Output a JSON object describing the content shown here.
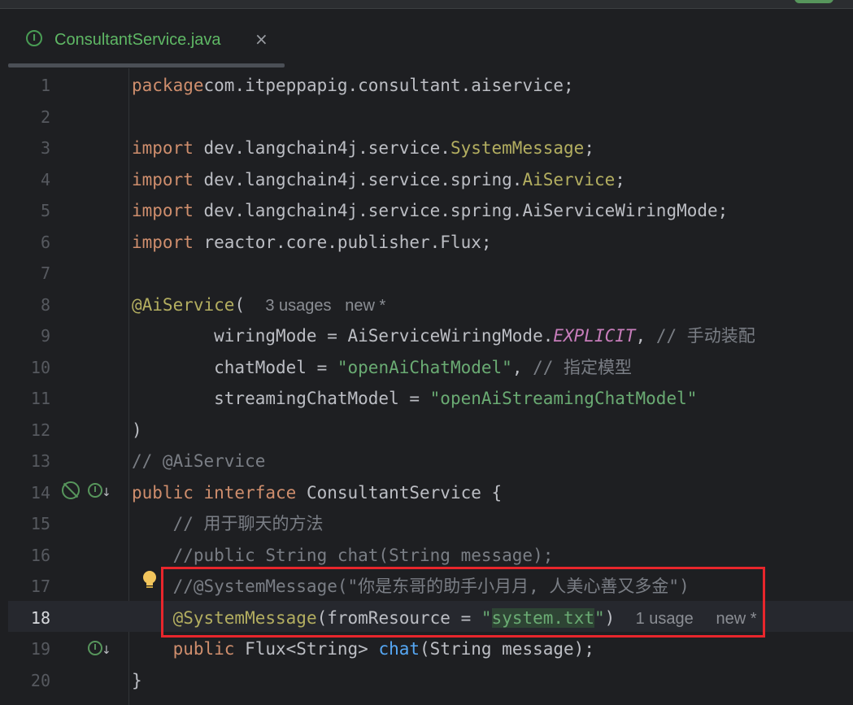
{
  "file_tab": {
    "icon": "interface-icon",
    "icon_letter": "I",
    "name": "ConsultantService.java",
    "close": "×"
  },
  "current_line": 18,
  "gutter_icons": {
    "line_14": [
      "no-implementation-icon",
      "implemented-interface-icon"
    ],
    "line_17": [
      "intention-bulb-icon"
    ],
    "line_19": [
      "implemented-method-icon"
    ]
  },
  "colors": {
    "keyword": "#cf8e6d",
    "annotation": "#b3ae60",
    "string": "#6aab73",
    "comment": "#7a7e85",
    "field": "#c77dbb",
    "method": "#56a8f5",
    "highlight_box": "#e8262c"
  },
  "lines": [
    {
      "n": "1",
      "t": [
        [
          "kw",
          "package"
        ],
        [
          "",
          "com.itpeppapig.consultant.aiservice;"
        ]
      ]
    },
    {
      "n": "2",
      "t": []
    },
    {
      "n": "3",
      "t": [
        [
          "kw",
          "import"
        ],
        [
          "",
          " dev.langchain4j.service."
        ],
        [
          "ann",
          "SystemMessage"
        ],
        [
          "",
          ";"
        ]
      ]
    },
    {
      "n": "4",
      "t": [
        [
          "kw",
          "import"
        ],
        [
          "",
          " dev.langchain4j.service.spring."
        ],
        [
          "ann",
          "AiService"
        ],
        [
          "",
          ";"
        ]
      ]
    },
    {
      "n": "5",
      "t": [
        [
          "kw",
          "import"
        ],
        [
          "",
          " dev.langchain4j.service.spring.AiServiceWiringMode;"
        ]
      ]
    },
    {
      "n": "6",
      "t": [
        [
          "kw",
          "import"
        ],
        [
          "",
          " reactor.core.publisher.Flux;"
        ]
      ]
    },
    {
      "n": "7",
      "t": []
    },
    {
      "n": "8",
      "t": [
        [
          "ann",
          "@AiService"
        ],
        [
          "",
          "(  "
        ],
        [
          "hint",
          "3 usages   new *"
        ]
      ]
    },
    {
      "n": "9",
      "t": [
        [
          "",
          "        wiringMode = AiServiceWiringMode."
        ],
        [
          "fld",
          "EXPLICIT"
        ],
        [
          "",
          ", "
        ],
        [
          "cmt",
          "// 手动装配"
        ]
      ]
    },
    {
      "n": "10",
      "t": [
        [
          "",
          "        chatModel = "
        ],
        [
          "str",
          "\"openAiChatModel\""
        ],
        [
          "",
          ", "
        ],
        [
          "cmt",
          "// 指定模型"
        ]
      ]
    },
    {
      "n": "11",
      "t": [
        [
          "",
          "        streamingChatModel = "
        ],
        [
          "str",
          "\"openAiStreamingChatModel\""
        ]
      ]
    },
    {
      "n": "12",
      "t": [
        [
          "",
          ")"
        ]
      ]
    },
    {
      "n": "13",
      "t": [
        [
          "cmt",
          "// @AiService"
        ]
      ]
    },
    {
      "n": "14",
      "t": [
        [
          "kw",
          "public interface"
        ],
        [
          "",
          " ConsultantService {"
        ]
      ]
    },
    {
      "n": "15",
      "t": [
        [
          "cmt",
          "    // 用于聊天的方法"
        ]
      ]
    },
    {
      "n": "16",
      "t": [
        [
          "cmt",
          "    //public String chat(String message);"
        ]
      ]
    },
    {
      "n": "17",
      "t": [
        [
          "cmt",
          "    //@SystemMessage(\"你是东哥的助手小月月, 人美心善又多金\")"
        ]
      ]
    },
    {
      "n": "18",
      "t": [
        [
          "",
          "    "
        ],
        [
          "ann",
          "@SystemMessage"
        ],
        [
          "",
          "(fromResource = "
        ],
        [
          "str",
          "\""
        ],
        [
          "strhl",
          "system.txt"
        ],
        [
          "str",
          "\""
        ],
        [
          "",
          ")  "
        ],
        [
          "hint",
          "1 usage     new *"
        ]
      ]
    },
    {
      "n": "19",
      "t": [
        [
          "kw",
          "    public"
        ],
        [
          "",
          " Flux<String> "
        ],
        [
          "fn",
          "chat"
        ],
        [
          "",
          "(String message);"
        ]
      ]
    },
    {
      "n": "20",
      "t": [
        [
          "",
          "}"
        ]
      ]
    }
  ]
}
